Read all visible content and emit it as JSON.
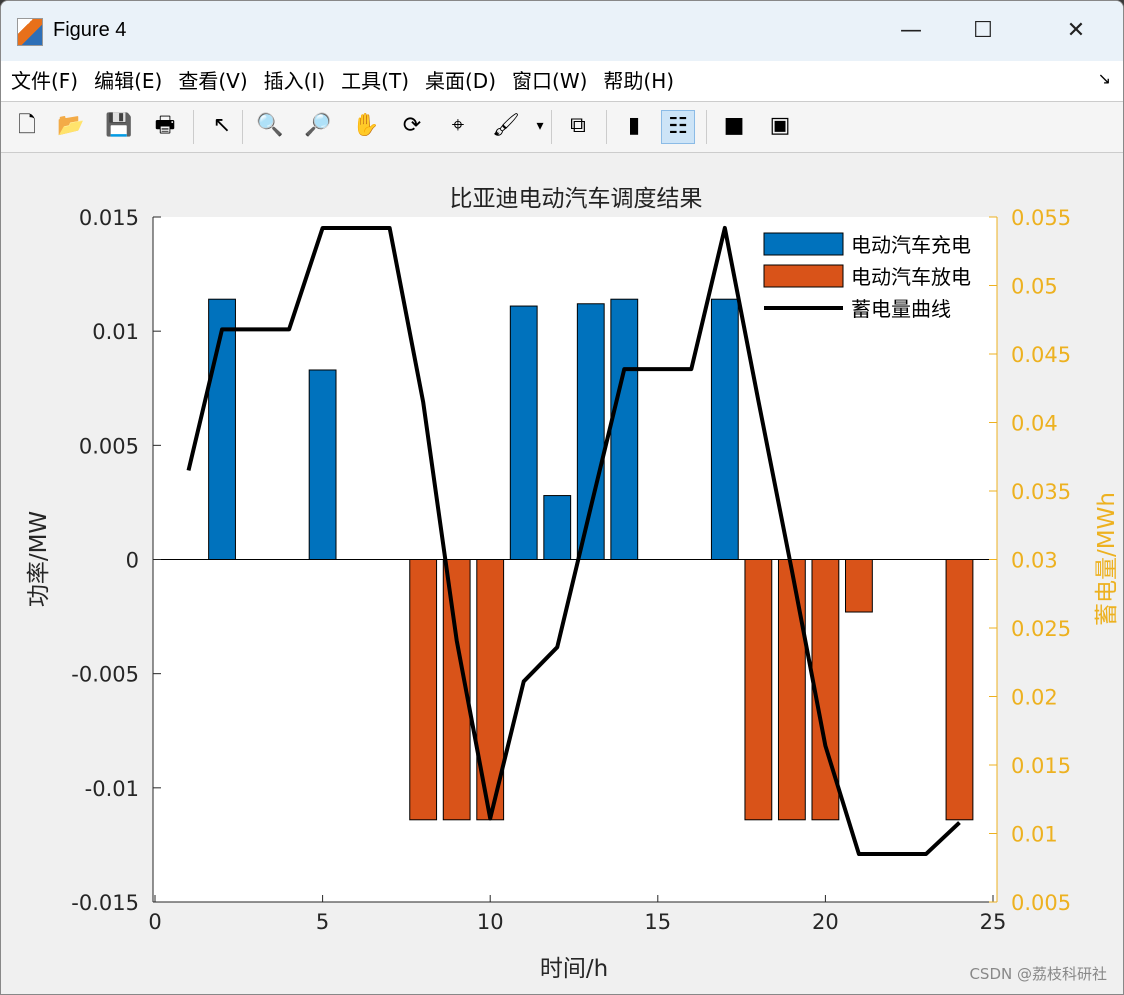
{
  "window": {
    "title": "Figure 4",
    "minimize": "—",
    "maximize": "☐",
    "close": "✕"
  },
  "menu": [
    "文件(F)",
    "编辑(E)",
    "查看(V)",
    "插入(I)",
    "工具(T)",
    "桌面(D)",
    "窗口(W)",
    "帮助(H)"
  ],
  "menu_arrow": "↘",
  "toolbar": [
    {
      "name": "new-figure-icon",
      "glyph": "🗋"
    },
    {
      "name": "open-file-icon",
      "glyph": "📂"
    },
    {
      "name": "save-icon",
      "glyph": "💾"
    },
    {
      "name": "print-icon",
      "glyph": "🖶"
    },
    {
      "name": "pointer-icon",
      "glyph": "↖"
    },
    {
      "name": "zoom-in-icon",
      "glyph": "🔍"
    },
    {
      "name": "zoom-out-icon",
      "glyph": "🔎"
    },
    {
      "name": "pan-hand-icon",
      "glyph": "✋"
    },
    {
      "name": "rotate-3d-icon",
      "glyph": "⟳"
    },
    {
      "name": "data-cursor-icon",
      "glyph": "⌖"
    },
    {
      "name": "brush-icon",
      "glyph": "🖌"
    },
    {
      "name": "brush-dropdown-icon",
      "glyph": "▾"
    },
    {
      "name": "link-plot-icon",
      "glyph": "⧉"
    },
    {
      "name": "colorbar-icon",
      "glyph": "▮"
    },
    {
      "name": "legend-icon",
      "glyph": "☷"
    },
    {
      "name": "hide-plot-tools-icon",
      "glyph": "■"
    },
    {
      "name": "show-plot-tools-icon",
      "glyph": "▣"
    }
  ],
  "watermark": "CSDN @荔枝科研社",
  "colors": {
    "charge": "#0072bd",
    "discharge": "#d95319",
    "line": "#000000",
    "right_axis": "#edb120"
  },
  "chart_data": {
    "type": "bar",
    "title": "比亚迪电动汽车调度结果",
    "xlabel": "时间/h",
    "ylabel": "功率/MW",
    "ylabel_right": "蓄电量/MWh",
    "xlim": [
      0,
      25
    ],
    "ylim": [
      -0.015,
      0.015
    ],
    "ylim_right": [
      0.005,
      0.055
    ],
    "xticks": [
      "0",
      "5",
      "10",
      "15",
      "20",
      "25"
    ],
    "yticks": [
      "-0.015",
      "-0.01",
      "-0.005",
      "0",
      "0.005",
      "0.01",
      "0.015"
    ],
    "yticks_right": [
      "0.005",
      "0.01",
      "0.015",
      "0.02",
      "0.025",
      "0.03",
      "0.035",
      "0.04",
      "0.045",
      "0.05",
      "0.055"
    ],
    "x": [
      1,
      2,
      3,
      4,
      5,
      6,
      7,
      8,
      9,
      10,
      11,
      12,
      13,
      14,
      15,
      16,
      17,
      18,
      19,
      20,
      21,
      22,
      23,
      24
    ],
    "legend_position": "top-right",
    "series": [
      {
        "name": "电动汽车充电",
        "type": "bar",
        "values": [
          0,
          0.0114,
          0,
          0,
          0.0083,
          0,
          0,
          0,
          0,
          0,
          0.0111,
          0.0028,
          0.0112,
          0.0114,
          0,
          0,
          0.0114,
          0,
          0,
          0,
          0,
          0,
          0,
          0
        ]
      },
      {
        "name": "电动汽车放电",
        "type": "bar",
        "values": [
          0,
          0,
          0,
          0,
          0,
          0,
          0,
          -0.0114,
          -0.0114,
          -0.0114,
          0,
          0,
          0,
          0,
          0,
          0,
          0,
          -0.0114,
          -0.0114,
          -0.0114,
          -0.0023,
          0,
          0,
          -0.0114
        ]
      },
      {
        "name": "蓄电量曲线",
        "type": "line",
        "axis": "right",
        "values": [
          0.0365,
          0.0468,
          0.0468,
          0.0468,
          0.0542,
          0.0542,
          0.0542,
          0.0415,
          0.0241,
          0.0111,
          0.0211,
          0.0236,
          0.0338,
          0.0439,
          0.0439,
          0.0439,
          0.0542,
          0.0416,
          0.0292,
          0.0164,
          0.0085,
          0.0085,
          0.0085,
          0.0108
        ]
      }
    ]
  }
}
